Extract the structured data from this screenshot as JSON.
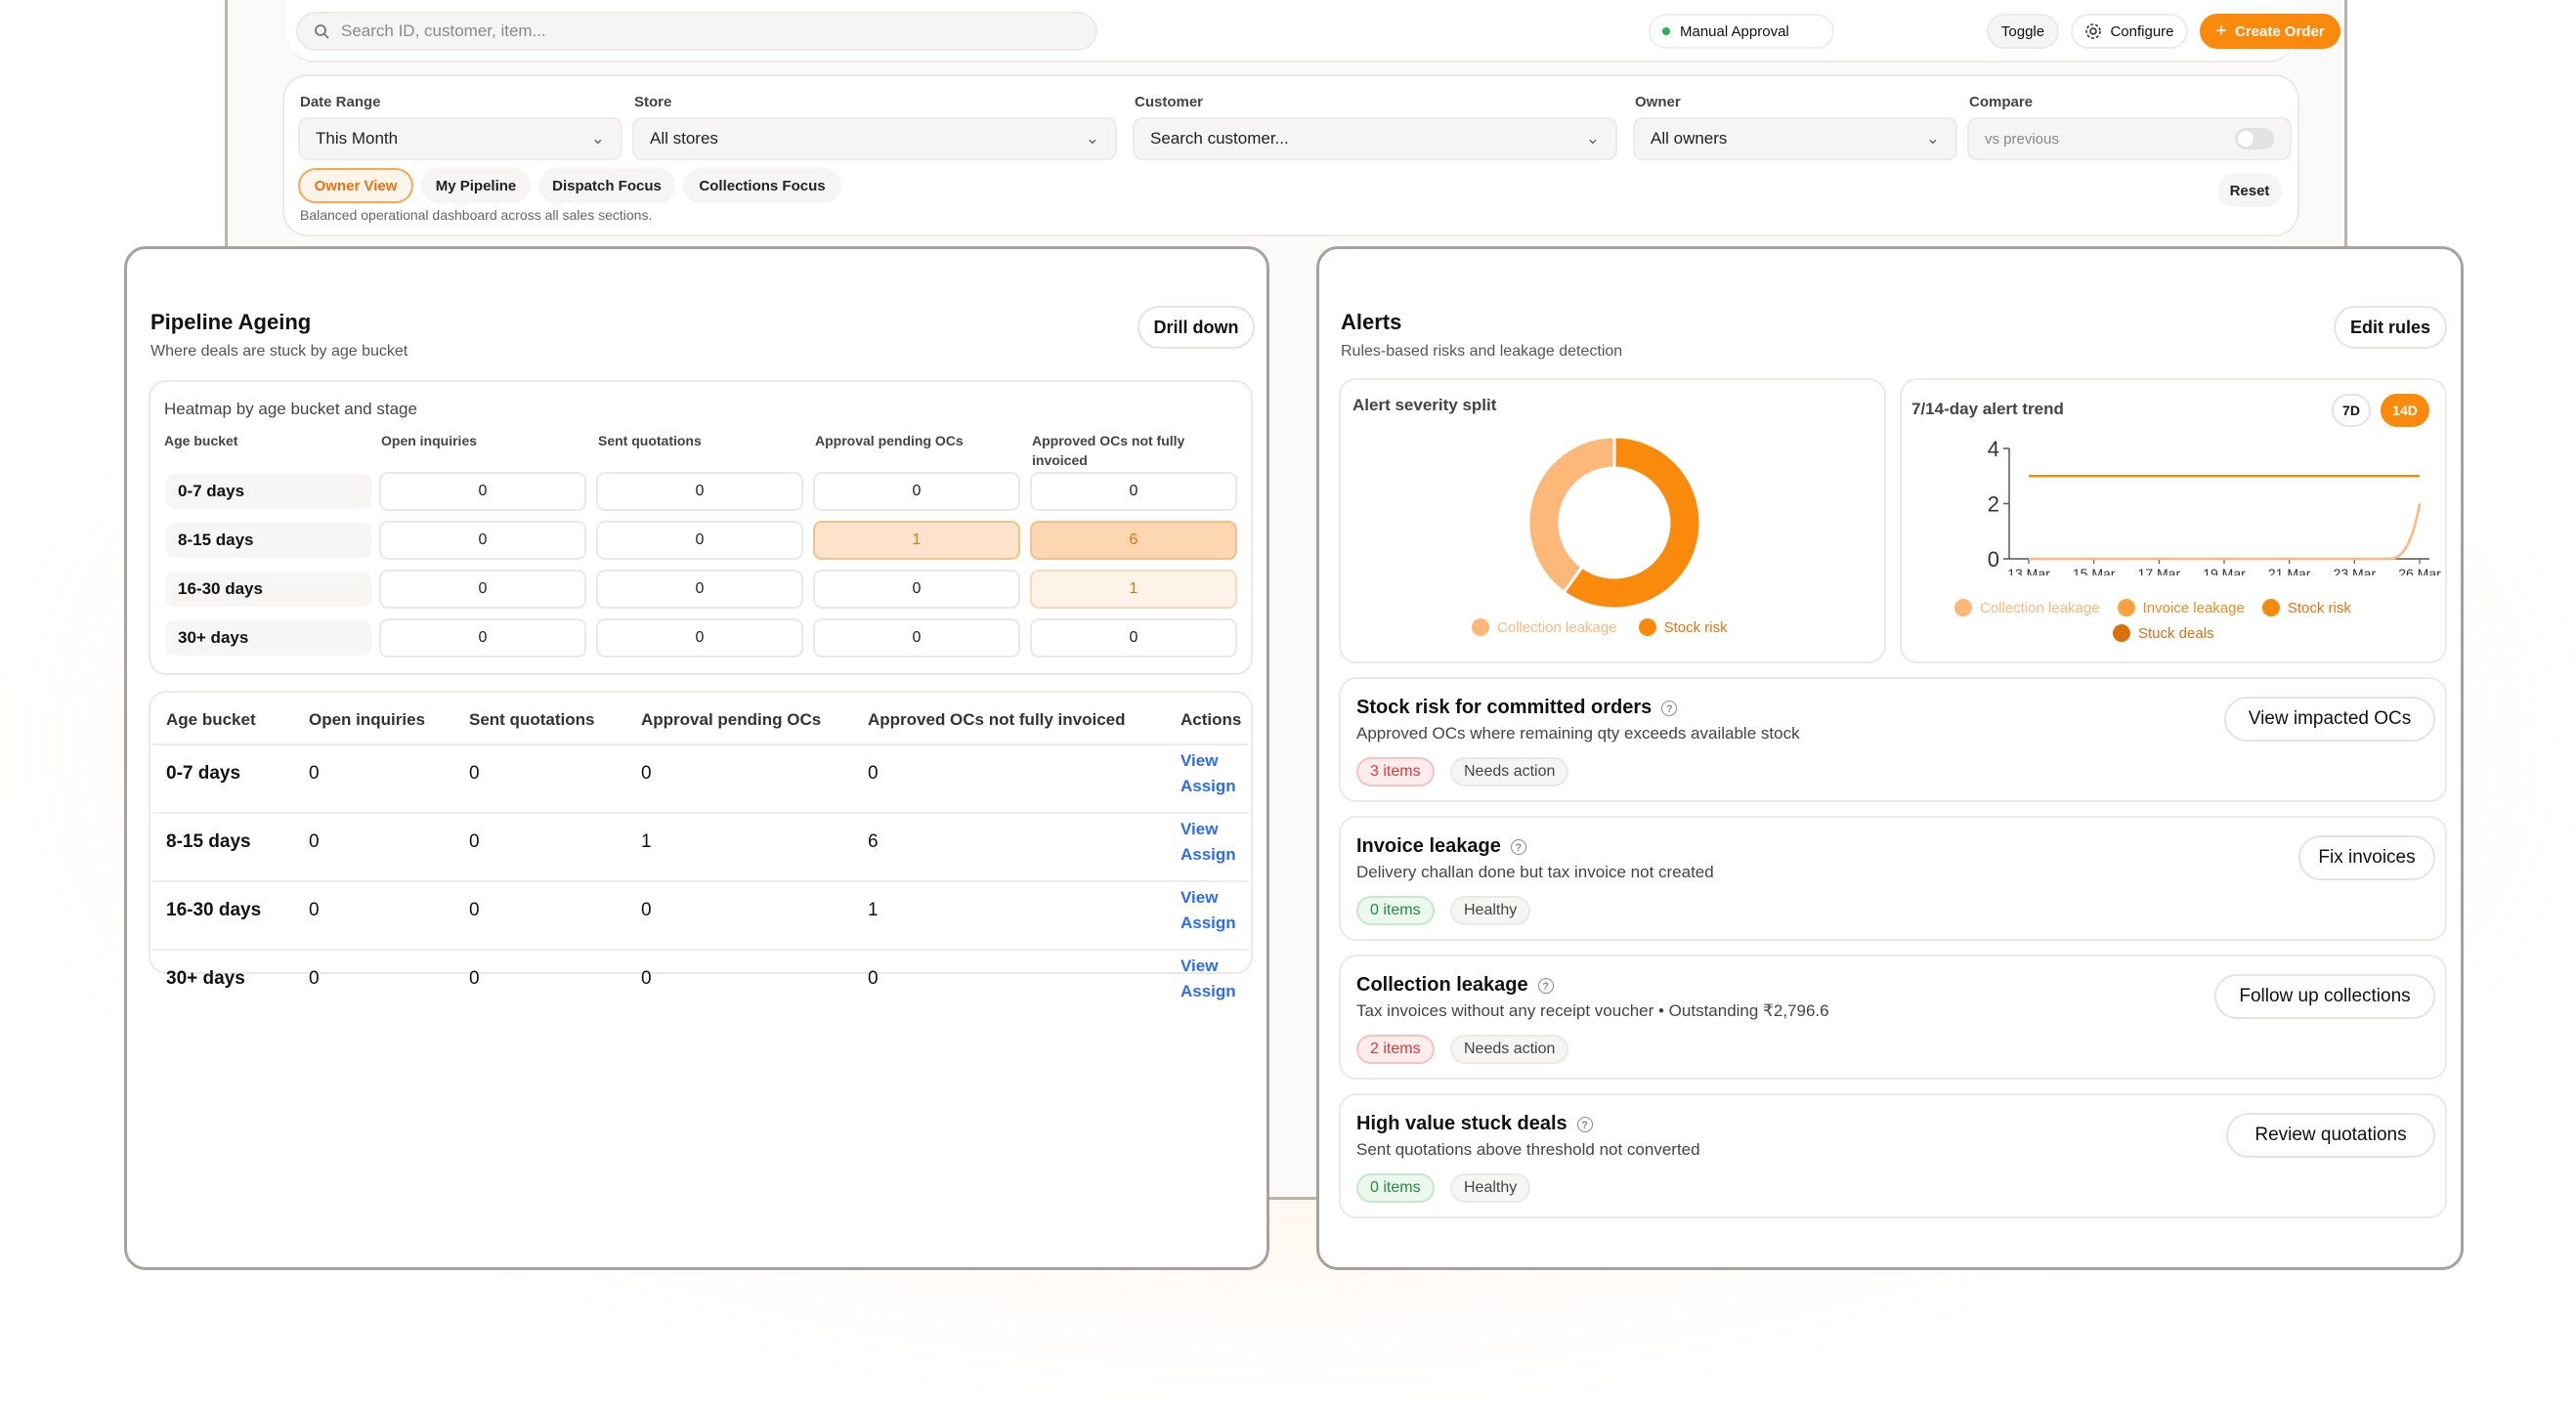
{
  "topbar": {
    "search_placeholder": "Search ID, customer, item...",
    "approval_status": "Manual Approval",
    "toggle_label": "Toggle",
    "configure_label": "Configure",
    "create_order_label": "Create Order"
  },
  "filters": {
    "date_range": {
      "label": "Date Range",
      "value": "This Month"
    },
    "store": {
      "label": "Store",
      "value": "All stores"
    },
    "customer": {
      "label": "Customer",
      "value": "Search customer..."
    },
    "owner": {
      "label": "Owner",
      "value": "All owners"
    },
    "compare": {
      "label": "Compare",
      "value": "vs previous"
    },
    "views": [
      "Owner View",
      "My Pipeline",
      "Dispatch Focus",
      "Collections Focus"
    ],
    "active_view": "Owner View",
    "description": "Balanced operational dashboard across all sales sections.",
    "reset_label": "Reset"
  },
  "pipeline": {
    "title": "Pipeline Ageing",
    "subtitle": "Where deals are stuck by age bucket",
    "drill_label": "Drill down",
    "heatmap": {
      "title": "Heatmap by age bucket and stage",
      "col_bucket": "Age bucket",
      "columns": [
        "Open inquiries",
        "Sent quotations",
        "Approval pending OCs",
        "Approved OCs not fully invoiced"
      ],
      "rows": [
        {
          "bucket": "0-7 days",
          "values": [
            "0",
            "0",
            "0",
            "0"
          ]
        },
        {
          "bucket": "8-15 days",
          "values": [
            "0",
            "0",
            "1",
            "6"
          ]
        },
        {
          "bucket": "16-30 days",
          "values": [
            "0",
            "0",
            "0",
            "1"
          ]
        },
        {
          "bucket": "30+ days",
          "values": [
            "0",
            "0",
            "0",
            "0"
          ]
        }
      ]
    },
    "table": {
      "headers": [
        "Age bucket",
        "Open inquiries",
        "Sent quotations",
        "Approval pending OCs",
        "Approved OCs not fully invoiced",
        "Actions"
      ],
      "rows": [
        {
          "bucket": "0-7 days",
          "values": [
            "0",
            "0",
            "0",
            "0"
          ]
        },
        {
          "bucket": "8-15 days",
          "values": [
            "0",
            "0",
            "1",
            "6"
          ]
        },
        {
          "bucket": "16-30 days",
          "values": [
            "0",
            "0",
            "0",
            "1"
          ]
        },
        {
          "bucket": "30+ days",
          "values": [
            "0",
            "0",
            "0",
            "0"
          ]
        }
      ],
      "view_label": "View",
      "assign_label": "Assign"
    }
  },
  "alerts": {
    "title": "Alerts",
    "subtitle": "Rules-based risks and leakage detection",
    "edit_label": "Edit rules",
    "severity": {
      "title": "Alert severity split",
      "legend": [
        "Collection leakage",
        "Stock risk"
      ]
    },
    "trend": {
      "title": "7/14-day alert trend",
      "range_7": "7D",
      "range_14": "14D",
      "legend": [
        "Collection leakage",
        "Invoice leakage",
        "Stock risk",
        "Stuck deals"
      ]
    },
    "items": [
      {
        "title": "Stock risk for committed orders",
        "desc": "Approved OCs where remaining qty exceeds available stock",
        "count": "3 items",
        "status": "Needs action",
        "action": "View impacted OCs"
      },
      {
        "title": "Invoice leakage",
        "desc": "Delivery challan done but tax invoice not created",
        "count": "0 items",
        "status": "Healthy",
        "action": "Fix invoices"
      },
      {
        "title": "Collection leakage",
        "desc": "Tax invoices without any receipt voucher • Outstanding ₹2,796.6",
        "count": "2 items",
        "status": "Needs action",
        "action": "Follow up collections"
      },
      {
        "title": "High value stuck deals",
        "desc": "Sent quotations above threshold not converted",
        "count": "0 items",
        "status": "Healthy",
        "action": "Review quotations"
      }
    ]
  },
  "chart_data": [
    {
      "type": "pie",
      "title": "Alert severity split",
      "categories": [
        "Collection leakage",
        "Stock risk"
      ],
      "values": [
        2,
        3
      ],
      "colors": [
        "#fbb878",
        "#f98a0c"
      ]
    },
    {
      "type": "line",
      "title": "7/14-day alert trend",
      "x": [
        "13 Mar",
        "15 Mar",
        "17 Mar",
        "19 Mar",
        "21 Mar",
        "23 Mar",
        "26 Mar"
      ],
      "ylim": [
        0,
        4
      ],
      "yticks": [
        "0",
        "2",
        "4"
      ],
      "series": [
        {
          "name": "Stock risk",
          "color": "#f08a1a",
          "values": [
            3,
            3,
            3,
            3,
            3,
            3,
            3
          ]
        },
        {
          "name": "Collection leakage",
          "color": "#fbb878",
          "values": [
            0,
            0,
            0,
            0,
            0,
            0,
            2
          ]
        }
      ]
    }
  ]
}
